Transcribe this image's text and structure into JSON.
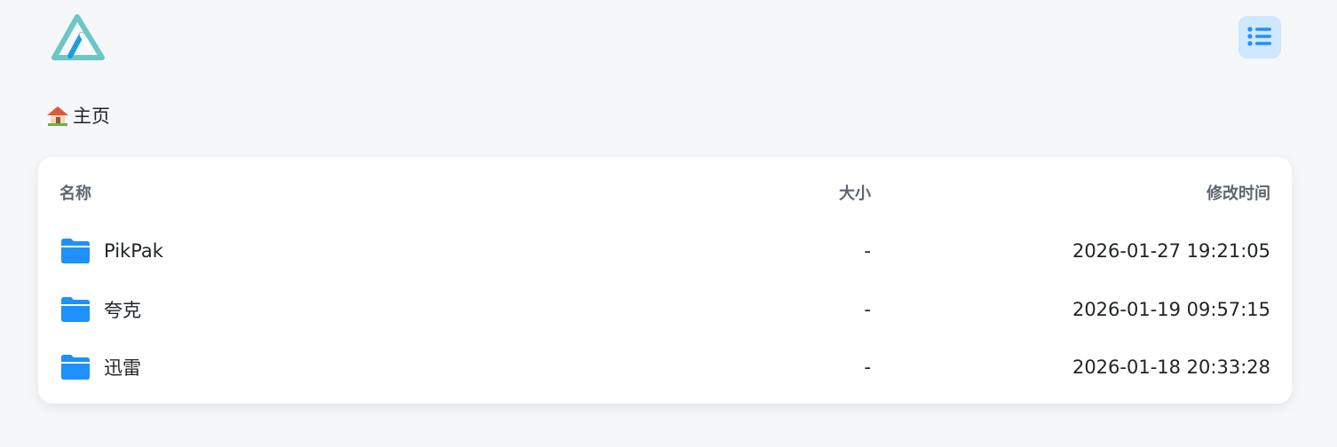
{
  "header": {
    "logo": "alist-logo-icon",
    "menu_icon": "list-view-icon"
  },
  "breadcrumb": {
    "home_icon": "house-icon",
    "label": "主页"
  },
  "table": {
    "columns": {
      "name": "名称",
      "size": "大小",
      "modified": "修改时间"
    },
    "rows": [
      {
        "icon": "folder-icon",
        "name": "PikPak",
        "size": "-",
        "modified": "2026-01-27 19:21:05"
      },
      {
        "icon": "folder-icon",
        "name": "夸克",
        "size": "-",
        "modified": "2026-01-19 09:57:15"
      },
      {
        "icon": "folder-icon",
        "name": "迅雷",
        "size": "-",
        "modified": "2026-01-18 20:33:28"
      }
    ]
  },
  "colors": {
    "accent": "#1e90ff",
    "menu_bg": "#cfe7ff",
    "logo_teal": "#6cc7c5",
    "logo_blue": "#1b9de0",
    "background": "#f6f7f9"
  }
}
